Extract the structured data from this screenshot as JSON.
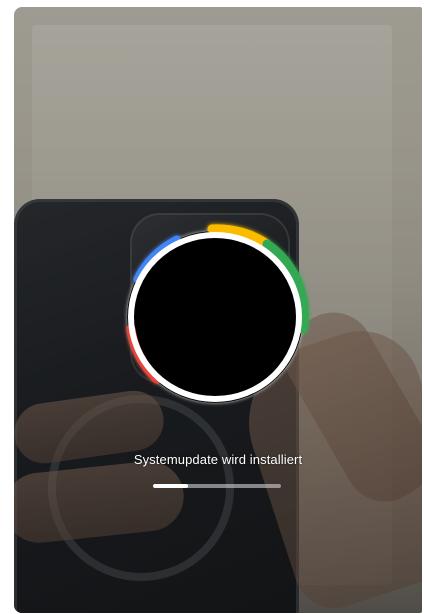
{
  "screen": {
    "status_text": "Systemupdate wird installiert",
    "progress_fraction": 0.27
  },
  "ring": {
    "colors": [
      "#ea4335",
      "#fbbc05",
      "#34a853",
      "#4285f4",
      "#ffffff"
    ]
  }
}
